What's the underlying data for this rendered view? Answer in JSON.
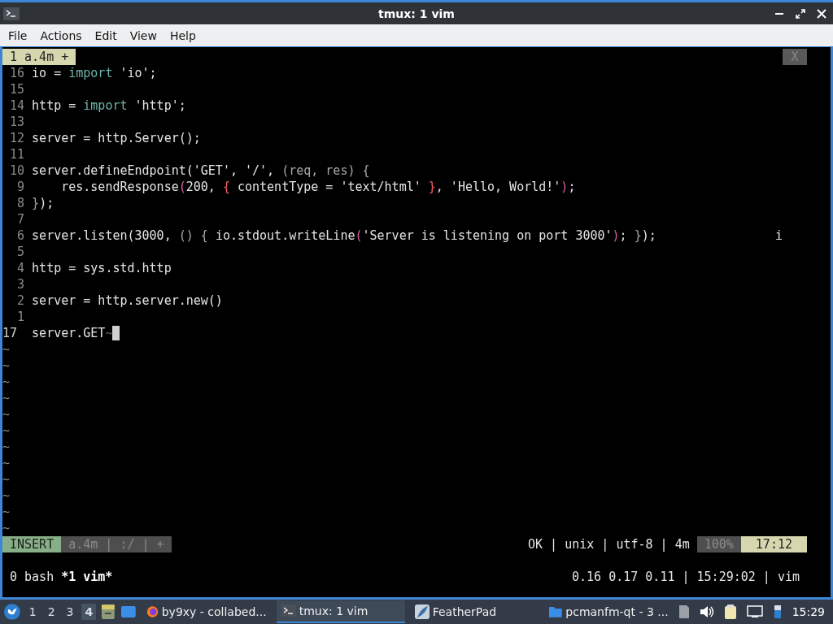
{
  "window": {
    "title": "tmux: 1 vim"
  },
  "menu": [
    "File",
    "Actions",
    "Edit",
    "View",
    "Help"
  ],
  "tabline": {
    "label": "1 a.4m +",
    "close": "X"
  },
  "lines": [
    {
      "number": "16",
      "current": false,
      "segments": [
        {
          "text": "io = ",
          "kind": "plain"
        },
        {
          "text": "import",
          "kind": "keyword"
        },
        {
          "text": " 'io';",
          "kind": "plain"
        }
      ]
    },
    {
      "number": "15",
      "current": false
    },
    {
      "number": "14",
      "current": false,
      "segments": [
        {
          "text": "http = ",
          "kind": "plain"
        },
        {
          "text": "import",
          "kind": "keyword"
        },
        {
          "text": " 'http';",
          "kind": "plain"
        }
      ]
    },
    {
      "number": "13",
      "current": false
    },
    {
      "number": "12",
      "current": false,
      "segments": [
        {
          "text": "server = http.Server();",
          "kind": "plain"
        }
      ]
    },
    {
      "number": "11",
      "current": false
    },
    {
      "number": "10",
      "current": false,
      "segments": [
        {
          "text": "server.defineEndpoint('GET', '/', ",
          "kind": "plain"
        },
        {
          "text": "(req, res) {",
          "kind": "dim"
        }
      ]
    },
    {
      "number": "9",
      "current": false,
      "segments": [
        {
          "text": "    res.sendResponse",
          "kind": "plain"
        },
        {
          "text": "(",
          "kind": "paren"
        },
        {
          "text": "200, ",
          "kind": "plain"
        },
        {
          "text": "{",
          "kind": "brace"
        },
        {
          "text": " contentType = 'text/html' ",
          "kind": "plain"
        },
        {
          "text": "}",
          "kind": "brace"
        },
        {
          "text": ", 'Hello, World!'",
          "kind": "plain"
        },
        {
          "text": ")",
          "kind": "paren"
        },
        {
          "text": ";",
          "kind": "plain"
        }
      ]
    },
    {
      "number": "8",
      "current": false,
      "segments": [
        {
          "text": "}",
          "kind": "dim"
        },
        {
          "text": ");",
          "kind": "plain"
        }
      ]
    },
    {
      "number": "7",
      "current": false
    },
    {
      "number": "6",
      "current": false,
      "segments": [
        {
          "text": "server.listen(3000, ",
          "kind": "plain"
        },
        {
          "text": "() { ",
          "kind": "dim"
        },
        {
          "text": "io.stdout.writeLine",
          "kind": "plain"
        },
        {
          "text": "(",
          "kind": "paren"
        },
        {
          "text": "'Server is listening on port 3000'",
          "kind": "plain"
        },
        {
          "text": ")",
          "kind": "paren"
        },
        {
          "text": "; ",
          "kind": "plain"
        },
        {
          "text": "}",
          "kind": "dim"
        },
        {
          "text": ");",
          "kind": "plain"
        }
      ],
      "trailing": "i"
    },
    {
      "number": "5",
      "current": false
    },
    {
      "number": "4",
      "current": false,
      "segments": [
        {
          "text": "http = sys.std.http",
          "kind": "plain"
        }
      ]
    },
    {
      "number": "3",
      "current": false
    },
    {
      "number": "2",
      "current": false,
      "segments": [
        {
          "text": "server = http.server.new()",
          "kind": "plain"
        }
      ]
    },
    {
      "number": "1",
      "current": false
    },
    {
      "number": "17",
      "current": true,
      "segments": [
        {
          "text": "server.GET",
          "kind": "plain"
        }
      ],
      "eol": "~",
      "cursor": true
    }
  ],
  "filler": [
    "~",
    "~",
    "~",
    "~",
    "~",
    "~",
    "~",
    "~",
    "~",
    "~",
    "~",
    "~"
  ],
  "statusline": {
    "left": [
      {
        "text": "INSERT",
        "kind": "mode"
      },
      {
        "text": "a.4m | :/ | +",
        "kind": "info"
      }
    ],
    "right": [
      {
        "text": "OK | unix | utf-8 | 4m",
        "kind": "plain"
      },
      {
        "text": "100%",
        "kind": "info"
      },
      {
        "text": "17:12",
        "kind": "position"
      }
    ]
  },
  "tmux": {
    "windows": [
      {
        "label": "0 bash",
        "selected": false
      },
      {
        "label": "*1 vim*",
        "selected": true
      }
    ],
    "status": "0.16 0.17 0.11 | 15:29:02 | vim"
  },
  "taskbar": {
    "workspaces": [
      {
        "label": "1",
        "selected": false
      },
      {
        "label": "2",
        "selected": false
      },
      {
        "label": "3",
        "selected": false
      },
      {
        "label": "4",
        "selected": true
      }
    ],
    "tasks": [
      {
        "label": "by9xy - collabed...",
        "kind": "browser",
        "selected": false
      },
      {
        "label": "tmux: 1 vim",
        "kind": "terminal",
        "selected": true
      },
      {
        "label": "FeatherPad",
        "kind": "feather",
        "selected": false
      },
      {
        "label": "pcmanfm-qt - 3 ...",
        "kind": "folder",
        "selected": false
      }
    ],
    "clock": "15:29"
  }
}
